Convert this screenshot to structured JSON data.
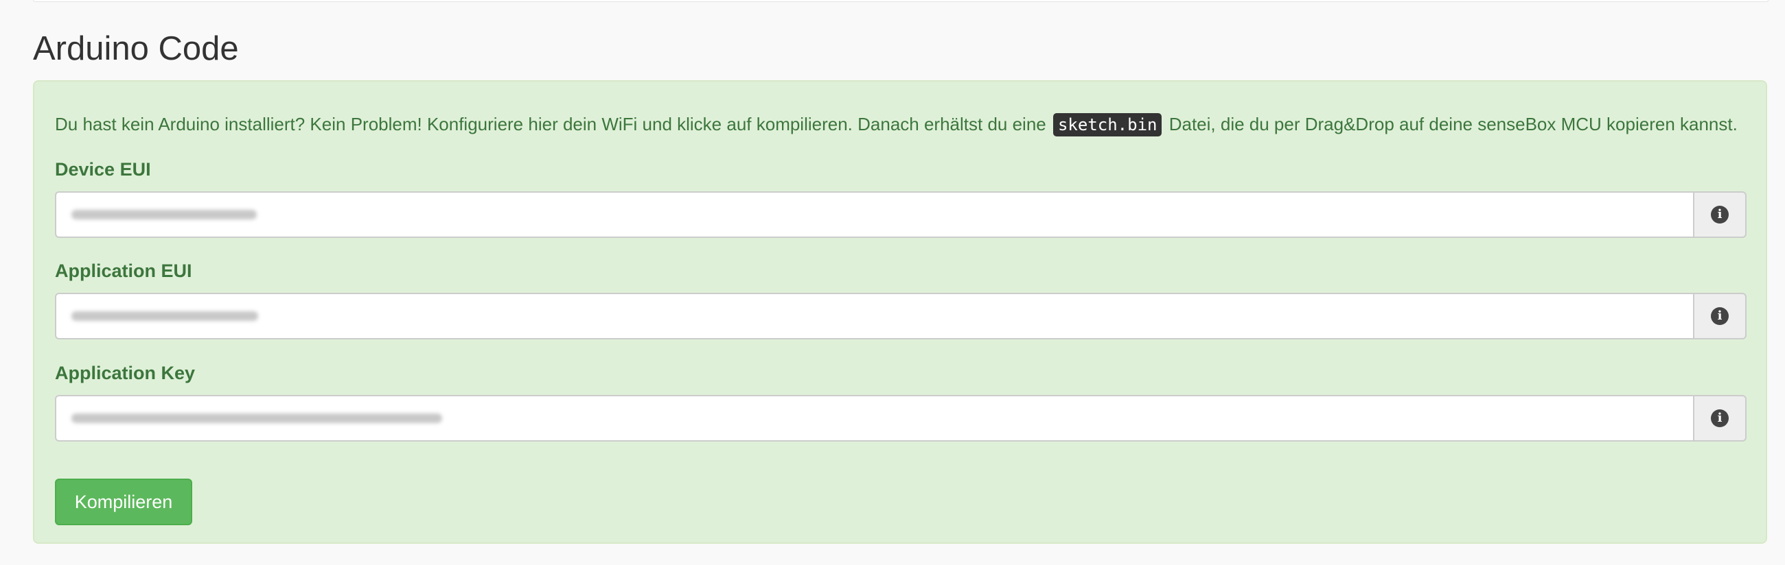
{
  "section": {
    "title": "Arduino Code"
  },
  "panel": {
    "intro_before": "Du hast kein Arduino installiert? Kein Problem! Konfiguriere hier dein WiFi und klicke auf kompilieren. Danach erhältst du eine",
    "intro_code": "sketch.bin",
    "intro_after": "Datei, die du per Drag&Drop auf deine senseBox MCU kopieren kannst."
  },
  "fields": [
    {
      "label": "Device EUI",
      "value": "",
      "icon": "info-circle-icon"
    },
    {
      "label": "Application EUI",
      "value": "",
      "icon": "info-circle-icon"
    },
    {
      "label": "Application Key",
      "value": "",
      "icon": "info-circle-icon"
    }
  ],
  "button": {
    "label": "Kompilieren"
  },
  "colors": {
    "panel_bg": "#dff0d8",
    "panel_text": "#3c763d",
    "button_bg": "#5cb85c"
  }
}
